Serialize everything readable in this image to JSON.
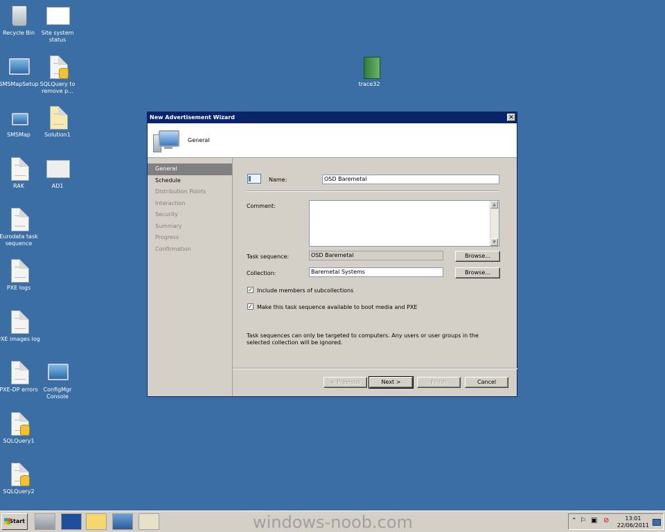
{
  "desktop": {
    "icons": [
      {
        "label": "Recycle Bin"
      },
      {
        "label": "Site system status"
      },
      {
        "label": "SMSMapSetup"
      },
      {
        "label": "SQLQuery to remove p..."
      },
      {
        "label": "SMSMap"
      },
      {
        "label": "Solution1"
      },
      {
        "label": "RAK"
      },
      {
        "label": "AD1"
      },
      {
        "label": "Eurodata task sequence"
      },
      {
        "label": "PXE logs"
      },
      {
        "label": "PXE images log"
      },
      {
        "label": "PXE-DP errors"
      },
      {
        "label": "ConfigMgr Console"
      },
      {
        "label": "SQLQuery1"
      },
      {
        "label": "SQLQuery2"
      },
      {
        "label": "trace32"
      }
    ]
  },
  "wizard": {
    "title": "New Advertisement Wizard",
    "close_glyph": "✕",
    "header_title": "General",
    "nav": [
      {
        "label": "General",
        "state": "active"
      },
      {
        "label": "Schedule",
        "state": "enabled"
      },
      {
        "label": "Distribution Points",
        "state": "disabled"
      },
      {
        "label": "Interaction",
        "state": "disabled"
      },
      {
        "label": "Security",
        "state": "disabled"
      },
      {
        "label": "Summary",
        "state": "disabled"
      },
      {
        "label": "Progress",
        "state": "disabled"
      },
      {
        "label": "Confirmation",
        "state": "disabled"
      }
    ],
    "form": {
      "name_label": "Name:",
      "name_value": "OSD Baremetal",
      "comment_label": "Comment:",
      "comment_value": "",
      "task_sequence_label": "Task sequence:",
      "task_sequence_value": "OSD Baremetal",
      "collection_label": "Collection:",
      "collection_value": "Baremetal Systems",
      "browse_label": "Browse...",
      "include_subcollections_label": "Include members of subcollections",
      "include_subcollections_checked": true,
      "boot_media_label": "Make this task sequence available to boot media and PXE",
      "boot_media_checked": true,
      "note": "Task sequences can only be targeted to computers.  Any users or user groups in the selected collection will be ignored."
    },
    "buttons": {
      "previous": "< Previous",
      "next": "Next >",
      "finish": "Finish",
      "cancel": "Cancel"
    }
  },
  "taskbar": {
    "start_label": "Start",
    "clock_time": "13:01",
    "clock_date": "22/06/2011",
    "watermark": "windows-noob.com"
  },
  "colors": {
    "desktop": "#3a6ea5",
    "titlebar": "#0a246a",
    "face": "#d4d0c8"
  }
}
